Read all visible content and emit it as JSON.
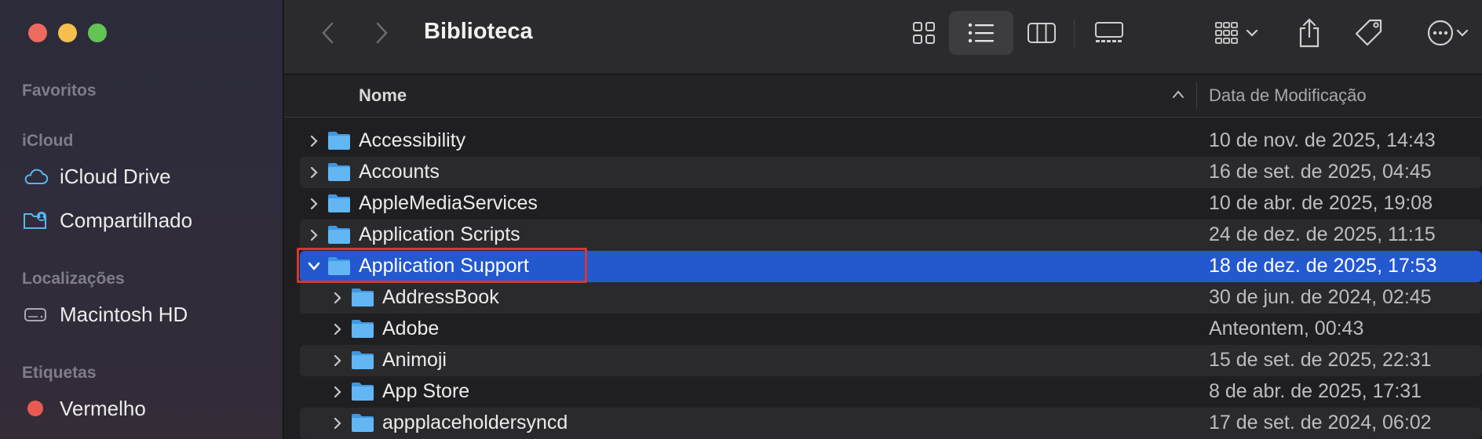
{
  "window": {
    "title": "Biblioteca"
  },
  "sidebar": {
    "sections": {
      "favorites": "Favoritos",
      "icloud": "iCloud",
      "locations": "Localizações",
      "tags": "Etiquetas"
    },
    "items": [
      {
        "label": "iCloud Drive",
        "icon": "icloud-icon"
      },
      {
        "label": "Compartilhado",
        "icon": "shared-folder-icon"
      },
      {
        "label": "Macintosh HD",
        "icon": "hard-drive-icon"
      },
      {
        "label": "Vermelho",
        "icon": "red-tag-dot"
      }
    ]
  },
  "toolbar": {
    "icons": [
      "back-icon",
      "forward-icon",
      "icon-view-icon",
      "list-view-icon",
      "column-view-icon",
      "gallery-view-icon",
      "group-icon",
      "share-icon",
      "tag-icon",
      "more-icon"
    ],
    "active_view": "list"
  },
  "columns": {
    "name": "Nome",
    "date": "Data de Modificação",
    "sort": "ascending"
  },
  "files": [
    {
      "name": "Accessibility",
      "date": "10 de nov. de 2025, 14:43",
      "level": 0,
      "expanded": false
    },
    {
      "name": "Accounts",
      "date": "16 de set. de 2025, 04:45",
      "level": 0,
      "expanded": false
    },
    {
      "name": "AppleMediaServices",
      "date": "10 de abr. de 2025, 19:08",
      "level": 0,
      "expanded": false
    },
    {
      "name": "Application Scripts",
      "date": "24 de dez. de 2025, 11:15",
      "level": 0,
      "expanded": false
    },
    {
      "name": "Application Support",
      "date": "18 de dez. de 2025, 17:53",
      "level": 0,
      "expanded": true,
      "selected": true
    },
    {
      "name": "AddressBook",
      "date": "30 de jun. de 2024, 02:45",
      "level": 1,
      "expanded": false
    },
    {
      "name": "Adobe",
      "date": "Anteontem, 00:43",
      "level": 1,
      "expanded": false
    },
    {
      "name": "Animoji",
      "date": "15 de set. de 2025, 22:31",
      "level": 1,
      "expanded": false
    },
    {
      "name": "App Store",
      "date": "8 de abr. de 2025, 17:31",
      "level": 1,
      "expanded": false
    },
    {
      "name": "appplaceholdersyncd",
      "date": "17 de set. de 2024, 06:02",
      "level": 1,
      "expanded": false
    }
  ],
  "colors": {
    "selection": "#2458cf",
    "folder": "#5fb3f1",
    "annotation": "#d7372c"
  }
}
